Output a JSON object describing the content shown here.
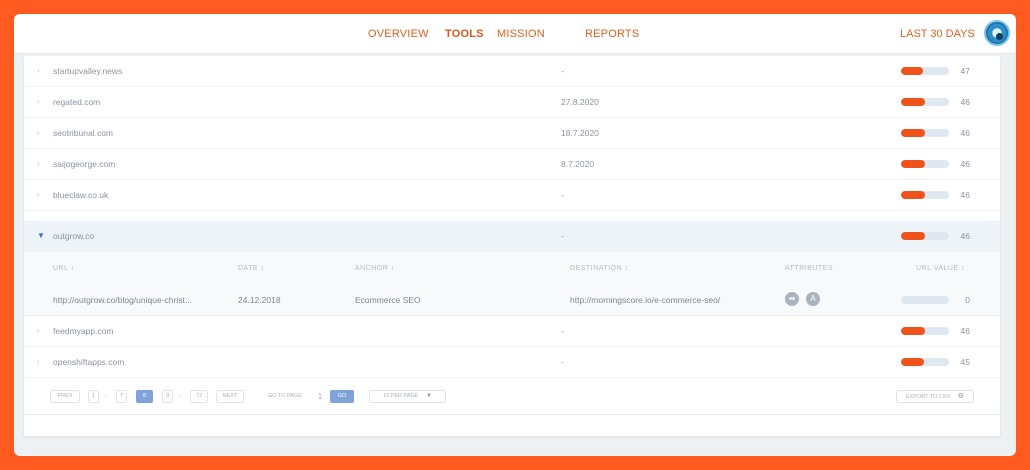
{
  "nav": {
    "items": [
      "OVERVIEW",
      "TOOLS",
      "MISSION",
      "REPORTS"
    ],
    "active": "TOOLS",
    "date_range": "LAST 30 DAYS",
    "caret": "▼"
  },
  "rows_top": [
    {
      "domain": "startupvalley.news",
      "date": "-",
      "score": "47",
      "fill": 0.45
    },
    {
      "domain": "regated.com",
      "date": "27.8.2020",
      "score": "46",
      "fill": 0.5
    },
    {
      "domain": "seotribunal.com",
      "date": "18.7.2020",
      "score": "46",
      "fill": 0.5
    },
    {
      "domain": "saijogeorge.com",
      "date": "8.7.2020",
      "score": "46",
      "fill": 0.5
    },
    {
      "domain": "blueclaw.co.uk",
      "date": "-",
      "score": "46",
      "fill": 0.5
    },
    {
      "domain": "outgrow.co",
      "date": "-",
      "score": "46",
      "fill": 0.5
    }
  ],
  "subtable": {
    "headers": {
      "url": "URL ↕",
      "date": "DATE ↕",
      "anchor": "ANCHOR ↕",
      "destination": "DESTINATION ↕",
      "attributes": "ATTRIBUTES",
      "url_value": "URL VALUE ↕"
    },
    "row": {
      "url": "http://outgrow.co/blog/unique-christ...",
      "date": "24.12.2018",
      "anchor": "Ecommerce SEO",
      "destination": "http://morningscore.io/e-commerce-seo/",
      "attr_icons": [
        "arrow-right-icon",
        "person-icon"
      ],
      "attr_glyphs": [
        "➡",
        "A"
      ],
      "score": "0"
    }
  },
  "rows_bottom": [
    {
      "domain": "feedmyapp.com",
      "date": "-",
      "score": "46",
      "fill": 0.5
    },
    {
      "domain": "openshiftapps.com",
      "date": "-",
      "score": "45",
      "fill": 0.48
    }
  ],
  "pagination": {
    "prev": "PREV",
    "first": "1",
    "ellipsis": "...",
    "prev_page": "7",
    "current": "8",
    "next_page": "9",
    "last": "72",
    "next": "NEXT",
    "goto_label": "GO TO PAGE",
    "goto_value": "1",
    "go": "GO",
    "per_page": "10 PER PAGE",
    "per_page_caret": "▼",
    "export": "EXPORT TO CSV"
  },
  "colors": {
    "accent": "#f0521c",
    "background": "#ff5a1f",
    "active_page": "#7fa3d9"
  }
}
